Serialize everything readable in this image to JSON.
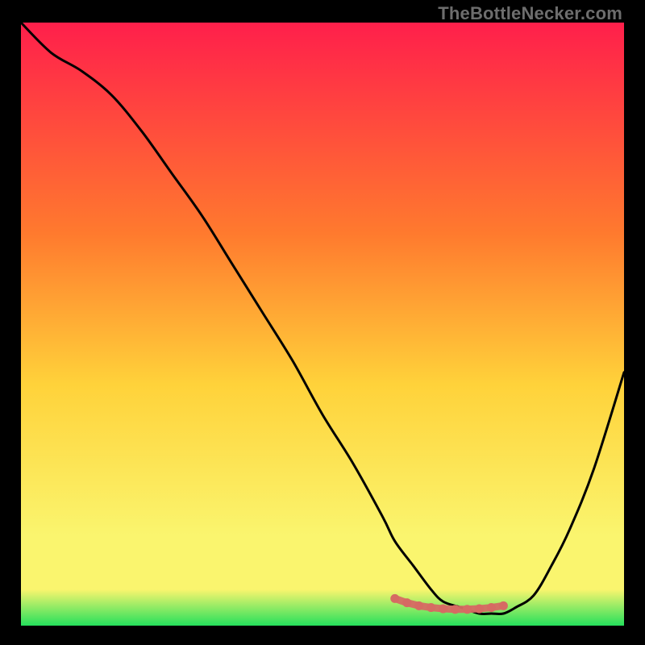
{
  "watermark": "TheBottleNecker.com",
  "colors": {
    "bg_black": "#000000",
    "gradient_top": "#ff1f4b",
    "gradient_mid_upper": "#ff7a2e",
    "gradient_mid": "#ffd23a",
    "gradient_mid_lower": "#faf56e",
    "gradient_bottom": "#25e05c",
    "curve": "#000000",
    "marker": "#d66a63"
  },
  "chart_data": {
    "type": "line",
    "title": "",
    "xlabel": "",
    "ylabel": "",
    "xlim": [
      0,
      100
    ],
    "ylim": [
      0,
      100
    ],
    "series": [
      {
        "name": "bottleneck-curve",
        "x": [
          0,
          5,
          10,
          15,
          20,
          25,
          30,
          35,
          40,
          45,
          50,
          55,
          60,
          62,
          65,
          68,
          70,
          73,
          76,
          78,
          80,
          82,
          85,
          88,
          91,
          95,
          100
        ],
        "y": [
          100,
          95,
          92,
          88,
          82,
          75,
          68,
          60,
          52,
          44,
          35,
          27,
          18,
          14,
          10,
          6,
          4,
          3,
          2,
          2,
          2,
          3,
          5,
          10,
          16,
          26,
          42
        ]
      }
    ],
    "markers": {
      "name": "optimal-region",
      "x": [
        62,
        64,
        66,
        68,
        70,
        72,
        74,
        76,
        78,
        80
      ],
      "y": [
        4.5,
        3.8,
        3.3,
        3.0,
        2.8,
        2.7,
        2.7,
        2.8,
        3.0,
        3.3
      ]
    }
  }
}
